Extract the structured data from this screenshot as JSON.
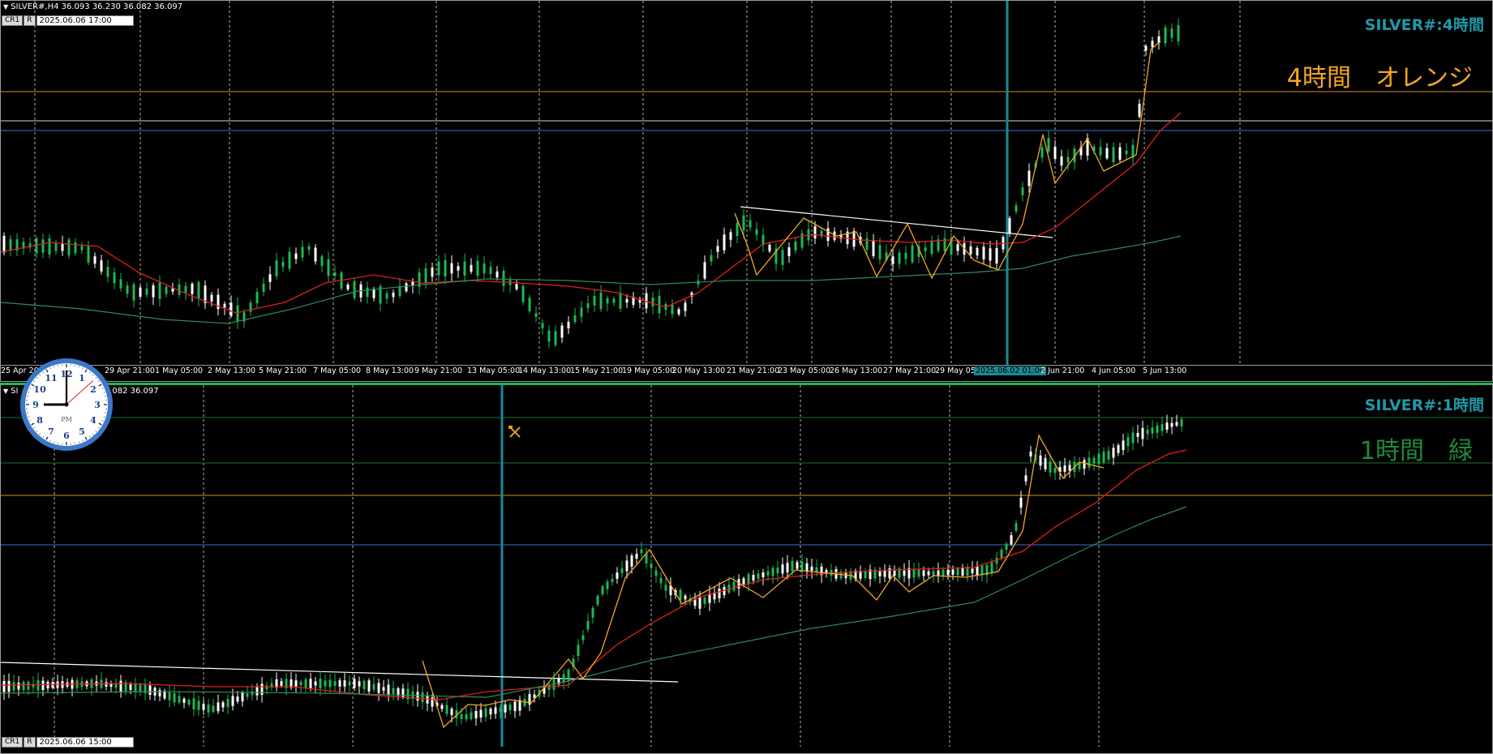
{
  "top_pane": {
    "header": "SILVER#,H4  36.093 36.230 36.082 36.097",
    "tf_buttons": [
      "CR1",
      "R"
    ],
    "datetime": "2025.06.06 17:00",
    "title": "SILVER#:4時間",
    "note": "4時間　オレンジ",
    "note_color": "#f5a623",
    "axis_labels": [
      "25 Apr 20",
      "29 Apr 21:00",
      "1 May 05:00",
      "2 May 13:00",
      "5 May 21:00",
      "7 May 05:00",
      "8 May 13:00",
      "9 May 21:00",
      "13 May 05:00",
      "14 May 13:00",
      "15 May 21:00",
      "19 May 05:00",
      "20 May 13:00",
      "21 May 21:00",
      "23 May 05:00",
      "26 May 13:00",
      "27 May 21:00",
      "29 May 05:",
      "2025.06.02 01:00",
      "2 Jun 21:00",
      "4 Jun 05:00",
      "5 Jun 13:00"
    ]
  },
  "bottom_pane": {
    "header": "SI",
    "header_tail": "36.082 36.097",
    "tf_buttons": [
      "CR1",
      "R"
    ],
    "datetime": "2025.06.06 15:00",
    "title": "SILVER#:1時間",
    "note": "1時間　緑",
    "note_color": "#1f8a3b"
  },
  "clock": {
    "label": "PM",
    "hour": 9,
    "minute": 0,
    "second": 8
  },
  "colors": {
    "background": "#000000",
    "ma_red": "#e0201a",
    "ma_green": "#2e8b57",
    "zigzag": "#f5a623",
    "vline": "#1a8a94",
    "hline_orange": "#e08a1e",
    "hline_blue": "#3a6fd8",
    "hline_green": "#1d6e2e",
    "candle_up": "#1db954",
    "candle_down": "#ffffff",
    "grid": "#b5b5b5"
  },
  "icons": {
    "tool": "crossed-tools-icon"
  }
}
